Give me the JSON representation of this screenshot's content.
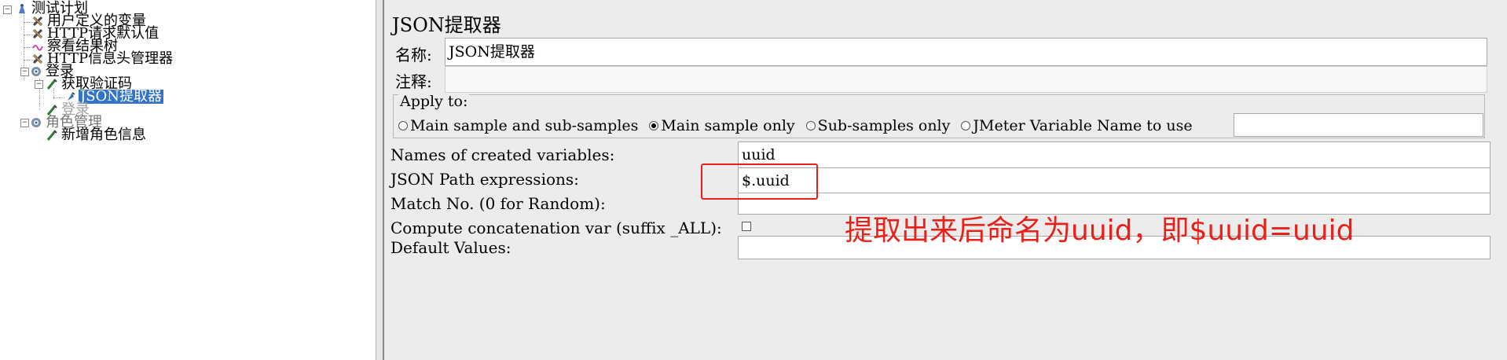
{
  "tree": {
    "items": [
      {
        "label": "测试计划",
        "icon": "test-plan-icon"
      },
      {
        "label": "用户定义的变量",
        "icon": "config-element-icon"
      },
      {
        "label": "HTTP请求默认值",
        "icon": "config-element-icon"
      },
      {
        "label": "察看结果树",
        "icon": "listener-icon"
      },
      {
        "label": "HTTP信息头管理器",
        "icon": "config-element-icon"
      },
      {
        "label": "登录",
        "icon": "thread-group-icon"
      },
      {
        "label": "获取验证码",
        "icon": "sampler-icon"
      },
      {
        "label": "JSON提取器",
        "icon": "post-processor-icon"
      },
      {
        "label": "登录",
        "icon": "sampler-icon"
      },
      {
        "label": "角色管理",
        "icon": "thread-group-icon"
      },
      {
        "label": "新增角色信息",
        "icon": "sampler-icon"
      }
    ]
  },
  "panel": {
    "title": "JSON提取器",
    "name_label": "名称:",
    "name_value": "JSON提取器",
    "comment_label": "注释:",
    "comment_value": "",
    "apply_to": {
      "legend": "Apply to:",
      "options": [
        {
          "label": "Main sample and sub-samples",
          "selected": false
        },
        {
          "label": "Main sample only",
          "selected": true
        },
        {
          "label": "Sub-samples only",
          "selected": false
        },
        {
          "label": "JMeter Variable Name to use",
          "selected": false
        }
      ],
      "variable_value": ""
    },
    "fields": {
      "names_label": "Names of created variables:",
      "names_value": "uuid",
      "json_path_label": "JSON Path expressions:",
      "json_path_value": "$.uuid",
      "match_label": "Match No. (0 for Random):",
      "match_value": "",
      "concat_label": "Compute concatenation var (suffix _ALL):",
      "concat_checked": false,
      "default_label": "Default Values:",
      "default_value": ""
    }
  },
  "annotation": {
    "text": "提取出来后命名为uuid，即$uuid=uuid",
    "color": "#e8221b"
  },
  "colors": {
    "selection": "#3474c6",
    "panel_bg": "#ececec"
  }
}
